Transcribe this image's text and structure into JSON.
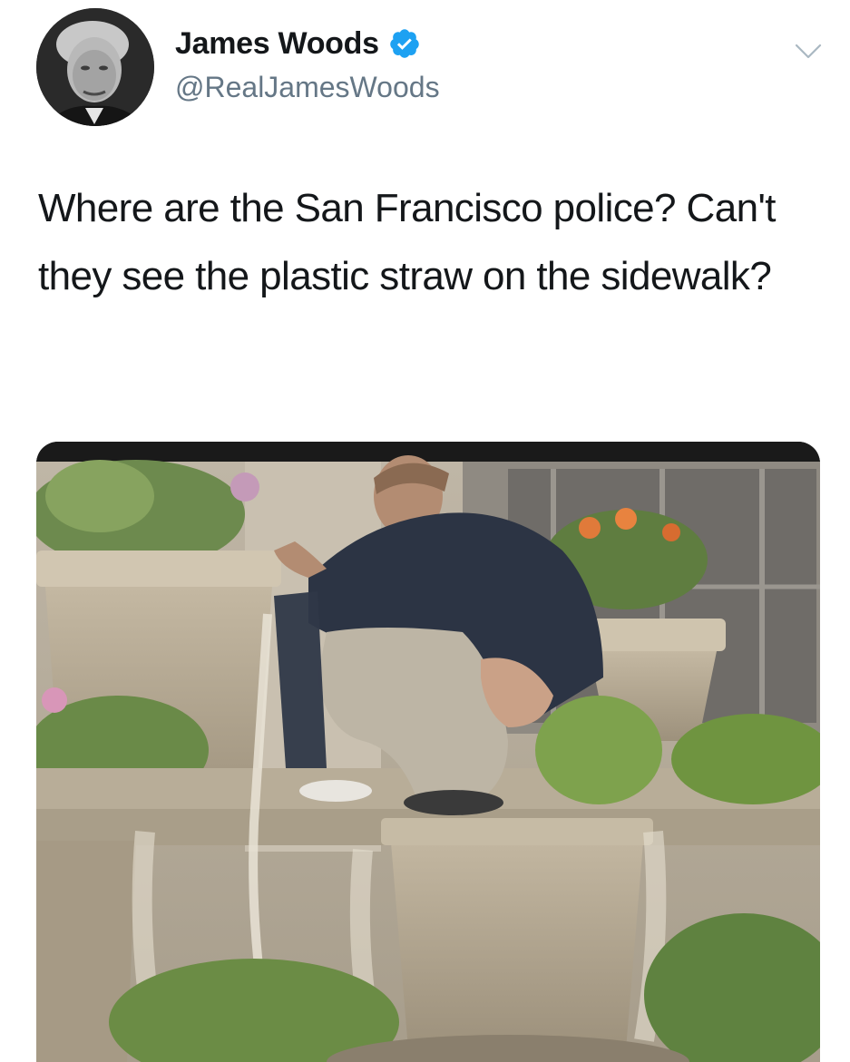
{
  "tweet": {
    "author": {
      "display_name": "James Woods",
      "handle": "@RealJamesWoods",
      "verified_icon": "verified-badge-icon",
      "avatar": "avatar-photo"
    },
    "menu_icon": "chevron-down-icon",
    "text": "Where are the San Francisco police? Can't they see the plastic straw on the sidewalk?",
    "media": {
      "type": "photo",
      "subject": "man-crouching-on-planter"
    }
  },
  "colors": {
    "text_primary": "#14171a",
    "text_secondary": "#657786",
    "verified_blue": "#1da1f2",
    "chevron_gray": "#aab8c2"
  }
}
